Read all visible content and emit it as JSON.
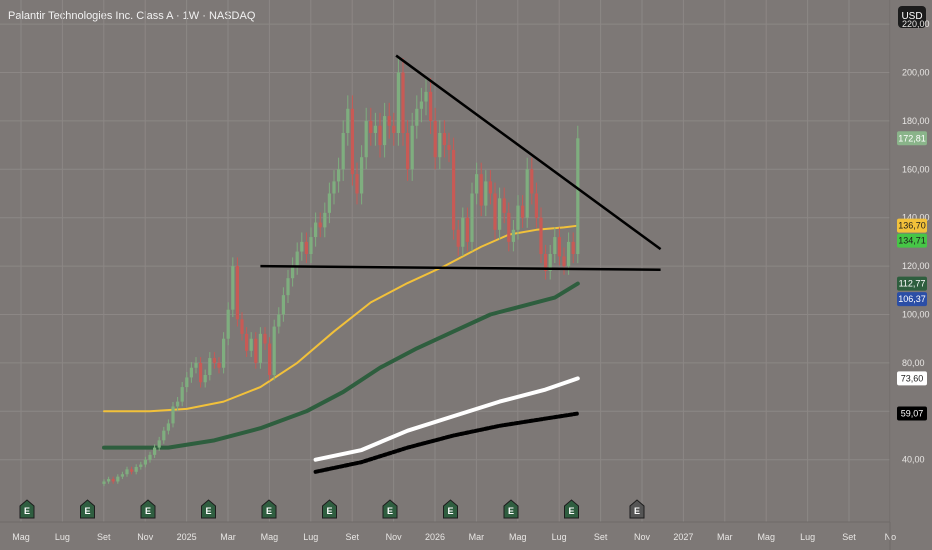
{
  "header": {
    "title": "Palantir Technologies Inc. Class A · 1W · NASDAQ",
    "currency": "USD"
  },
  "colors": {
    "background": "#7d7876",
    "grid": "#8c8785",
    "candle_up": "#7fae7f",
    "candle_down": "#c85a55",
    "sma_yellow": "#f2c13a",
    "sma_green": "#2e5e3e",
    "sma_white": "#ffffff",
    "sma_black": "#000000"
  },
  "chart_data": {
    "type": "candlestick",
    "ylim": [
      40,
      220
    ],
    "price_ticks": [
      "220,00",
      "200,00",
      "180,00",
      "160,00",
      "140,00",
      "120,00",
      "100,00",
      "80,00",
      "60,00",
      "40,00"
    ],
    "time_labels": [
      "Mag",
      "Lug",
      "Set",
      "Nov",
      "2025",
      "Mar",
      "Mag",
      "Lug",
      "Set",
      "Nov",
      "2026",
      "Mar",
      "Mag",
      "Lug",
      "Set",
      "Nov",
      "2027",
      "Mar",
      "Mag",
      "Lug",
      "Set",
      "No"
    ],
    "bars": [
      {
        "o": 30,
        "c": 31
      },
      {
        "o": 31,
        "c": 32
      },
      {
        "o": 32,
        "c": 31
      },
      {
        "o": 31,
        "c": 33
      },
      {
        "o": 33,
        "c": 34
      },
      {
        "o": 34,
        "c": 36
      },
      {
        "o": 36,
        "c": 35
      },
      {
        "o": 35,
        "c": 37
      },
      {
        "o": 37,
        "c": 38
      },
      {
        "o": 38,
        "c": 40
      },
      {
        "o": 40,
        "c": 42
      },
      {
        "o": 42,
        "c": 45
      },
      {
        "o": 45,
        "c": 48
      },
      {
        "o": 48,
        "c": 52
      },
      {
        "o": 52,
        "c": 55
      },
      {
        "o": 55,
        "c": 62
      },
      {
        "o": 62,
        "c": 64
      },
      {
        "o": 64,
        "c": 70
      },
      {
        "o": 70,
        "c": 74
      },
      {
        "o": 74,
        "c": 78
      },
      {
        "o": 78,
        "c": 80
      },
      {
        "o": 80,
        "c": 72
      },
      {
        "o": 72,
        "c": 75
      },
      {
        "o": 75,
        "c": 82
      },
      {
        "o": 82,
        "c": 80
      },
      {
        "o": 80,
        "c": 78
      },
      {
        "o": 78,
        "c": 90
      },
      {
        "o": 90,
        "c": 102
      },
      {
        "o": 102,
        "c": 120
      },
      {
        "o": 120,
        "c": 98
      },
      {
        "o": 98,
        "c": 92
      },
      {
        "o": 92,
        "c": 85
      },
      {
        "o": 85,
        "c": 90
      },
      {
        "o": 90,
        "c": 80
      },
      {
        "o": 80,
        "c": 92
      },
      {
        "o": 92,
        "c": 88
      },
      {
        "o": 88,
        "c": 75
      },
      {
        "o": 75,
        "c": 95
      },
      {
        "o": 95,
        "c": 100
      },
      {
        "o": 100,
        "c": 108
      },
      {
        "o": 108,
        "c": 115
      },
      {
        "o": 115,
        "c": 120
      },
      {
        "o": 120,
        "c": 126
      },
      {
        "o": 126,
        "c": 130
      },
      {
        "o": 130,
        "c": 125
      },
      {
        "o": 125,
        "c": 132
      },
      {
        "o": 132,
        "c": 138
      },
      {
        "o": 138,
        "c": 136
      },
      {
        "o": 136,
        "c": 142
      },
      {
        "o": 142,
        "c": 150
      },
      {
        "o": 150,
        "c": 155
      },
      {
        "o": 155,
        "c": 160
      },
      {
        "o": 160,
        "c": 175
      },
      {
        "o": 175,
        "c": 185
      },
      {
        "o": 185,
        "c": 158
      },
      {
        "o": 158,
        "c": 150
      },
      {
        "o": 150,
        "c": 165
      },
      {
        "o": 165,
        "c": 180
      },
      {
        "o": 180,
        "c": 175
      },
      {
        "o": 175,
        "c": 178
      },
      {
        "o": 178,
        "c": 170
      },
      {
        "o": 170,
        "c": 182
      },
      {
        "o": 182,
        "c": 178
      },
      {
        "o": 178,
        "c": 175
      },
      {
        "o": 175,
        "c": 200
      },
      {
        "o": 200,
        "c": 175
      },
      {
        "o": 175,
        "c": 160
      },
      {
        "o": 160,
        "c": 178
      },
      {
        "o": 178,
        "c": 185
      },
      {
        "o": 185,
        "c": 188
      },
      {
        "o": 188,
        "c": 192
      },
      {
        "o": 192,
        "c": 180
      },
      {
        "o": 180,
        "c": 165
      },
      {
        "o": 165,
        "c": 175
      },
      {
        "o": 175,
        "c": 170
      },
      {
        "o": 170,
        "c": 168
      },
      {
        "o": 168,
        "c": 135
      },
      {
        "o": 135,
        "c": 128
      },
      {
        "o": 128,
        "c": 140
      },
      {
        "o": 140,
        "c": 130
      },
      {
        "o": 130,
        "c": 150
      },
      {
        "o": 150,
        "c": 158
      },
      {
        "o": 158,
        "c": 145
      },
      {
        "o": 145,
        "c": 155
      },
      {
        "o": 155,
        "c": 150
      },
      {
        "o": 150,
        "c": 135
      },
      {
        "o": 135,
        "c": 148
      },
      {
        "o": 148,
        "c": 142
      },
      {
        "o": 142,
        "c": 130
      },
      {
        "o": 130,
        "c": 135
      },
      {
        "o": 135,
        "c": 145
      },
      {
        "o": 145,
        "c": 140
      },
      {
        "o": 140,
        "c": 160
      },
      {
        "o": 160,
        "c": 150
      },
      {
        "o": 150,
        "c": 140
      },
      {
        "o": 140,
        "c": 125
      },
      {
        "o": 125,
        "c": 118
      },
      {
        "o": 118,
        "c": 125
      },
      {
        "o": 125,
        "c": 132
      },
      {
        "o": 132,
        "c": 124
      },
      {
        "o": 124,
        "c": 120
      },
      {
        "o": 120,
        "c": 130
      },
      {
        "o": 130,
        "c": 125
      },
      {
        "o": 125,
        "c": 172.81
      }
    ],
    "series": [
      {
        "name": "",
        "color": "#f2c13a",
        "values": [
          [
            0,
            60
          ],
          [
            10,
            60
          ],
          [
            18,
            61
          ],
          [
            26,
            64
          ],
          [
            34,
            70
          ],
          [
            42,
            80
          ],
          [
            50,
            93
          ],
          [
            58,
            105
          ],
          [
            66,
            113
          ],
          [
            74,
            120
          ],
          [
            82,
            128
          ],
          [
            88,
            133
          ],
          [
            94,
            135
          ],
          [
            100,
            136
          ],
          [
            103,
            136.7
          ]
        ]
      },
      {
        "name": "",
        "color": "#2e5e3e",
        "values": [
          [
            0,
            45
          ],
          [
            14,
            45
          ],
          [
            24,
            48
          ],
          [
            34,
            53
          ],
          [
            44,
            60
          ],
          [
            52,
            68
          ],
          [
            60,
            78
          ],
          [
            68,
            86
          ],
          [
            76,
            93
          ],
          [
            84,
            100
          ],
          [
            92,
            104
          ],
          [
            98,
            107
          ],
          [
            103,
            112.77
          ]
        ]
      },
      {
        "name": "",
        "color": "#ffffff",
        "values": [
          [
            46,
            40
          ],
          [
            56,
            44
          ],
          [
            66,
            52
          ],
          [
            76,
            58
          ],
          [
            86,
            64
          ],
          [
            96,
            69
          ],
          [
            103,
            73.6
          ]
        ]
      },
      {
        "name": "",
        "color": "#000000",
        "values": [
          [
            46,
            35
          ],
          [
            56,
            39
          ],
          [
            66,
            45
          ],
          [
            76,
            50
          ],
          [
            86,
            54
          ],
          [
            96,
            57
          ],
          [
            103,
            59.07
          ]
        ]
      }
    ],
    "trendlines": [
      {
        "from": [
          63.5,
          207
        ],
        "to": [
          121,
          127
        ]
      },
      {
        "from": [
          34,
          120
        ],
        "to": [
          121,
          118.5
        ]
      }
    ],
    "last_values": [
      {
        "value": 172.81,
        "label": "172,81",
        "bg": "#8ab48a",
        "fg": "#ffffff"
      },
      {
        "value": 136.7,
        "label": "136,70",
        "bg": "#f2c13a",
        "fg": "#1c1c1c"
      },
      {
        "value": 134.71,
        "label": "134,71",
        "bg": "#46c646",
        "fg": "#1c1c1c"
      },
      {
        "value": 112.77,
        "label": "112,77",
        "bg": "#2e5e3e",
        "fg": "#ffffff"
      },
      {
        "value": 106.37,
        "label": "106,37",
        "bg": "#2b4ea6",
        "fg": "#ffffff"
      },
      {
        "value": 73.6,
        "label": "73,60",
        "bg": "#ffffff",
        "fg": "#1c1c1c"
      },
      {
        "value": 59.07,
        "label": "59,07",
        "bg": "#000000",
        "fg": "#ffffff"
      }
    ],
    "earnings_marker_label": "E"
  }
}
